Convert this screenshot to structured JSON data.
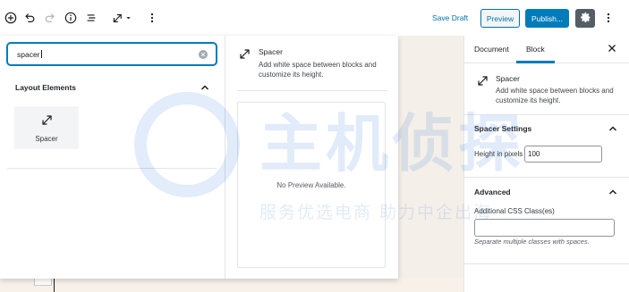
{
  "toolbar": {
    "add_icon": "plus-circle-icon",
    "undo_icon": "undo-icon",
    "redo_icon": "redo-icon",
    "info_icon": "info-icon",
    "outline_icon": "list-icon",
    "block_type_icon": "resize-arrow-icon",
    "more_icon": "vertical-ellipsis-icon",
    "save_draft": "Save Draft",
    "preview": "Preview",
    "publish": "Publish...",
    "settings_icon": "gear-icon"
  },
  "inserter": {
    "search_value": "spacer",
    "category_title": "Layout Elements",
    "results": [
      {
        "label": "Spacer",
        "icon": "resize-arrow-icon"
      }
    ],
    "preview": {
      "title": "Spacer",
      "description": "Add white space between blocks and customize its height.",
      "empty_text": "No Preview Available."
    }
  },
  "sidebar": {
    "tabs": [
      {
        "label": "Document",
        "active": false
      },
      {
        "label": "Block",
        "active": true
      }
    ],
    "block_card": {
      "title": "Spacer",
      "description": "Add white space between blocks and customize its height."
    },
    "spacer_settings": {
      "title": "Spacer Settings",
      "height_label": "Height in pixels",
      "height_value": "100"
    },
    "advanced": {
      "title": "Advanced",
      "css_label": "Additional CSS Class(es)",
      "css_value": "",
      "css_help": "Separate multiple classes with spaces."
    }
  },
  "watermark": {
    "big_text": "主机侦探",
    "small_text": "服务优选电商 助力中企出海"
  },
  "colors": {
    "accent": "#007cba",
    "link": "#0073aa",
    "settings_bg": "#555d66"
  }
}
